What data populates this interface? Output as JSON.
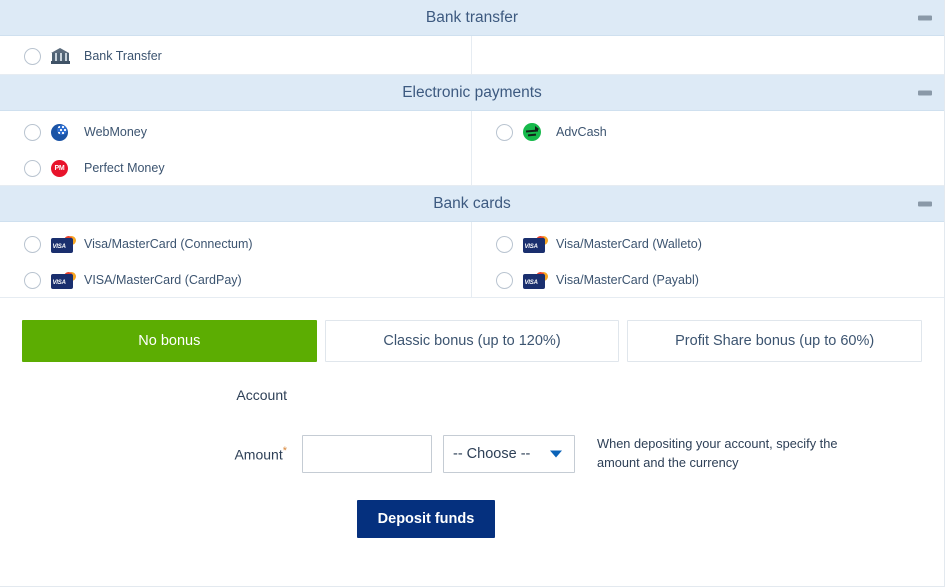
{
  "sections": [
    {
      "id": "bank-transfer",
      "title": "Bank transfer",
      "collapse_icon": "minus-icon",
      "options_left": [
        {
          "label": "Bank Transfer",
          "icon": "bank-icon",
          "selected": false
        }
      ],
      "options_right": []
    },
    {
      "id": "electronic-payments",
      "title": "Electronic payments",
      "collapse_icon": "minus-icon",
      "options_left": [
        {
          "label": "WebMoney",
          "icon": "webmoney-icon",
          "selected": false
        },
        {
          "label": "Perfect Money",
          "icon": "perfect-money-icon",
          "selected": false
        }
      ],
      "options_right": [
        {
          "label": "AdvCash",
          "icon": "advcash-icon",
          "selected": false
        }
      ]
    },
    {
      "id": "bank-cards",
      "title": "Bank cards",
      "collapse_icon": "minus-icon",
      "options_left": [
        {
          "label": "Visa/MasterCard (Connectum)",
          "icon": "visa-mastercard-icon",
          "selected": false
        },
        {
          "label": "VISA/MasterCard (CardPay)",
          "icon": "visa-mastercard-icon",
          "selected": false
        }
      ],
      "options_right": [
        {
          "label": "Visa/MasterCard (Walleto)",
          "icon": "visa-mastercard-icon",
          "selected": false
        },
        {
          "label": "Visa/MasterCard (Payabl)",
          "icon": "visa-mastercard-icon",
          "selected": false
        }
      ]
    }
  ],
  "bonus_tabs": [
    {
      "label": "No bonus",
      "active": true
    },
    {
      "label": "Classic bonus (up to 120%)",
      "active": false
    },
    {
      "label": "Profit Share bonus (up to 60%)",
      "active": false
    }
  ],
  "form": {
    "account_label": "Account",
    "account_value": "",
    "amount_label": "Amount",
    "required_mark": "*",
    "amount_value": "",
    "amount_placeholder": "",
    "currency_selected": "-- Choose --",
    "currency_caret": "chevron-down-icon",
    "hint": "When depositing your account, specify the amount and the currency",
    "submit_label": "Deposit funds"
  },
  "colors": {
    "header_bg": "#ddeaf6",
    "header_text": "#3d5a80",
    "active_tab_green": "#5cad02",
    "submit_blue": "#05307e",
    "pm_red": "#e8132b",
    "advcash_green": "#16b94b",
    "webmoney_blue": "#1b54a6",
    "visa_navy": "#1a2f6e"
  }
}
